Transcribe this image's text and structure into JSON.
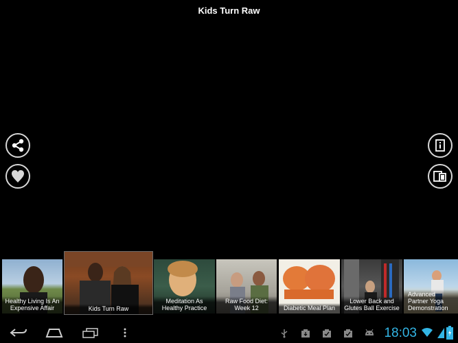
{
  "header": {
    "title": "Kids Turn Raw"
  },
  "actions": {
    "share": "share-icon",
    "favorite": "heart-icon",
    "info": "info-icon",
    "cast": "second-screen-icon"
  },
  "thumbnails": [
    {
      "caption": "Healthy Living Is An Expensive Affair"
    },
    {
      "caption": "Kids Turn Raw"
    },
    {
      "caption": "Meditation As Healthy Practice"
    },
    {
      "caption": "Raw Food Diet: Week 12"
    },
    {
      "caption": "Diabetic Meal Plan"
    },
    {
      "caption": "Lower Back and Glutes Ball Exercise"
    },
    {
      "caption": "Advanced Partner Yoga Demonstration"
    }
  ],
  "status": {
    "time": "18:03"
  },
  "colors": {
    "accent": "#33b5e5",
    "background": "#000000"
  }
}
